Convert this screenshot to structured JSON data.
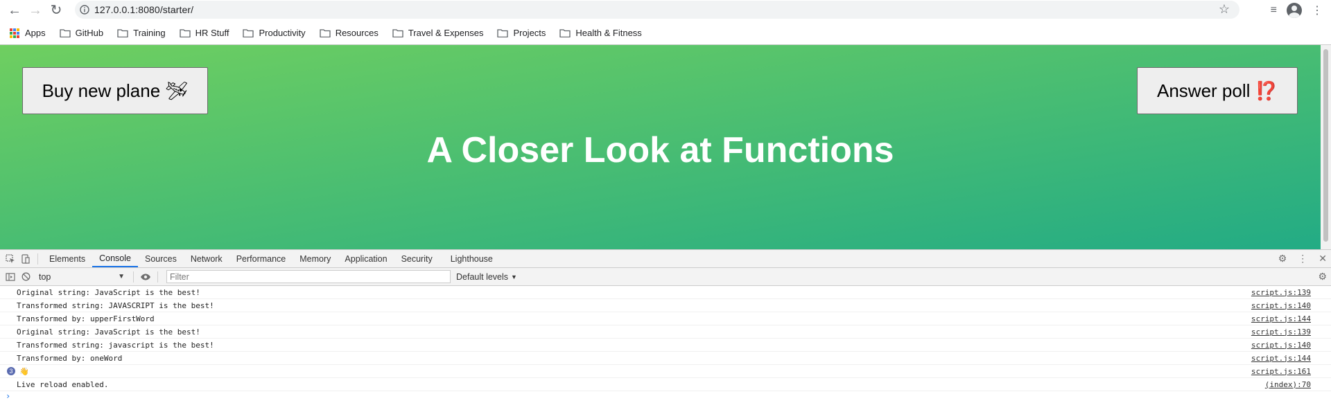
{
  "browser": {
    "url": "127.0.0.1:8080/starter/",
    "bookmarks": [
      {
        "label": "Apps"
      },
      {
        "label": "GitHub"
      },
      {
        "label": "Training"
      },
      {
        "label": "HR Stuff"
      },
      {
        "label": "Productivity"
      },
      {
        "label": "Resources"
      },
      {
        "label": "Travel & Expenses"
      },
      {
        "label": "Projects"
      },
      {
        "label": "Health & Fitness"
      }
    ]
  },
  "page": {
    "buy_button": "Buy new plane 🛩",
    "poll_button": "Answer poll ⁉️",
    "title": "A Closer Look at Functions",
    "gradient_colors": [
      "#6fcf60",
      "#22ab85"
    ]
  },
  "devtools": {
    "tabs": [
      "Elements",
      "Console",
      "Sources",
      "Network",
      "Performance",
      "Memory",
      "Application",
      "Security",
      "Lighthouse"
    ],
    "active_tab": "Console",
    "context": "top",
    "filter_placeholder": "Filter",
    "levels": "Default levels",
    "logs": [
      {
        "msg": "Original string: JavaScript is the best!",
        "src": "script.js:139"
      },
      {
        "msg": "Transformed string: JAVASCRIPT is the best!",
        "src": "script.js:140"
      },
      {
        "msg": "Transformed by: upperFirstWord",
        "src": "script.js:144"
      },
      {
        "msg": "Original string: JavaScript is the best!",
        "src": "script.js:139"
      },
      {
        "msg": "Transformed string: javascript is the best!",
        "src": "script.js:140"
      },
      {
        "msg": "Transformed by: oneWord",
        "src": "script.js:144"
      },
      {
        "msg": "👋",
        "src": "script.js:161",
        "count": "3"
      },
      {
        "msg": "Live reload enabled.",
        "src": "(index):70"
      }
    ],
    "prompt": "›"
  }
}
